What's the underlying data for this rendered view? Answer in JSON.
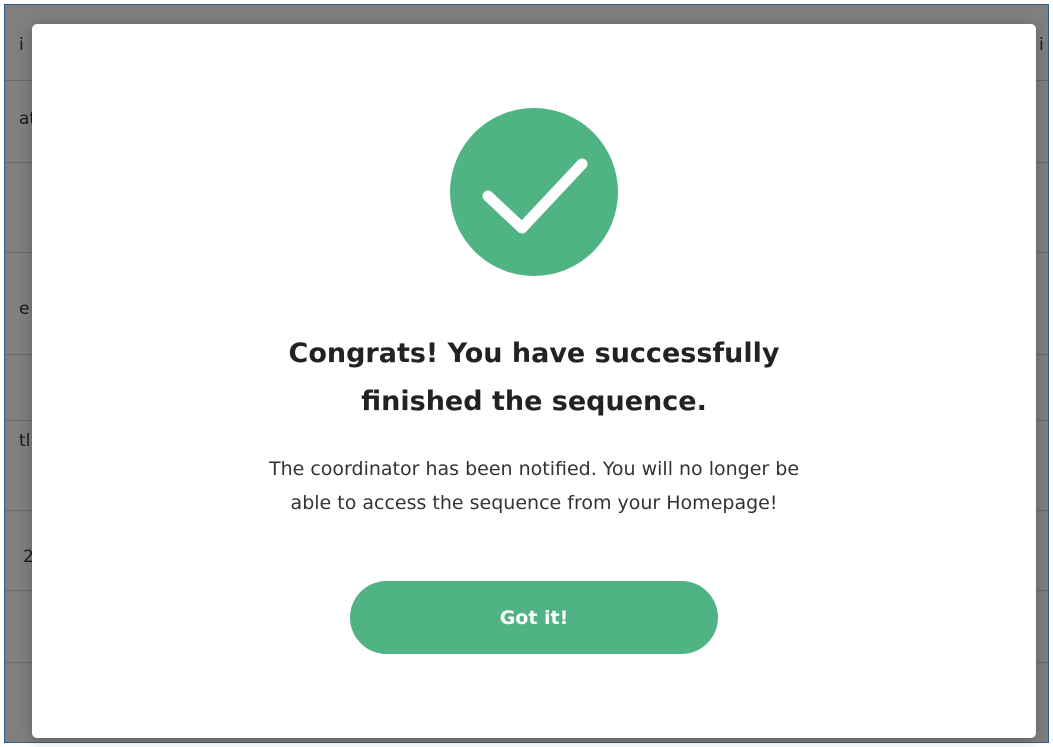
{
  "background": {
    "fragments": [
      "i",
      "at",
      "e",
      "tl",
      "2",
      "i"
    ]
  },
  "modal": {
    "icon": "check-circle-icon",
    "title_line1": "Congrats! You have successfully",
    "title_line2": "finished the sequence.",
    "message_line1": "The coordinator has been notified. You will no longer be",
    "message_line2": "able to access the sequence from your Homepage!",
    "button_label": "Got it!"
  },
  "colors": {
    "accent": "#4fb383",
    "frame": "#2f5f8a",
    "title_text": "#222222",
    "body_text": "#333333"
  }
}
